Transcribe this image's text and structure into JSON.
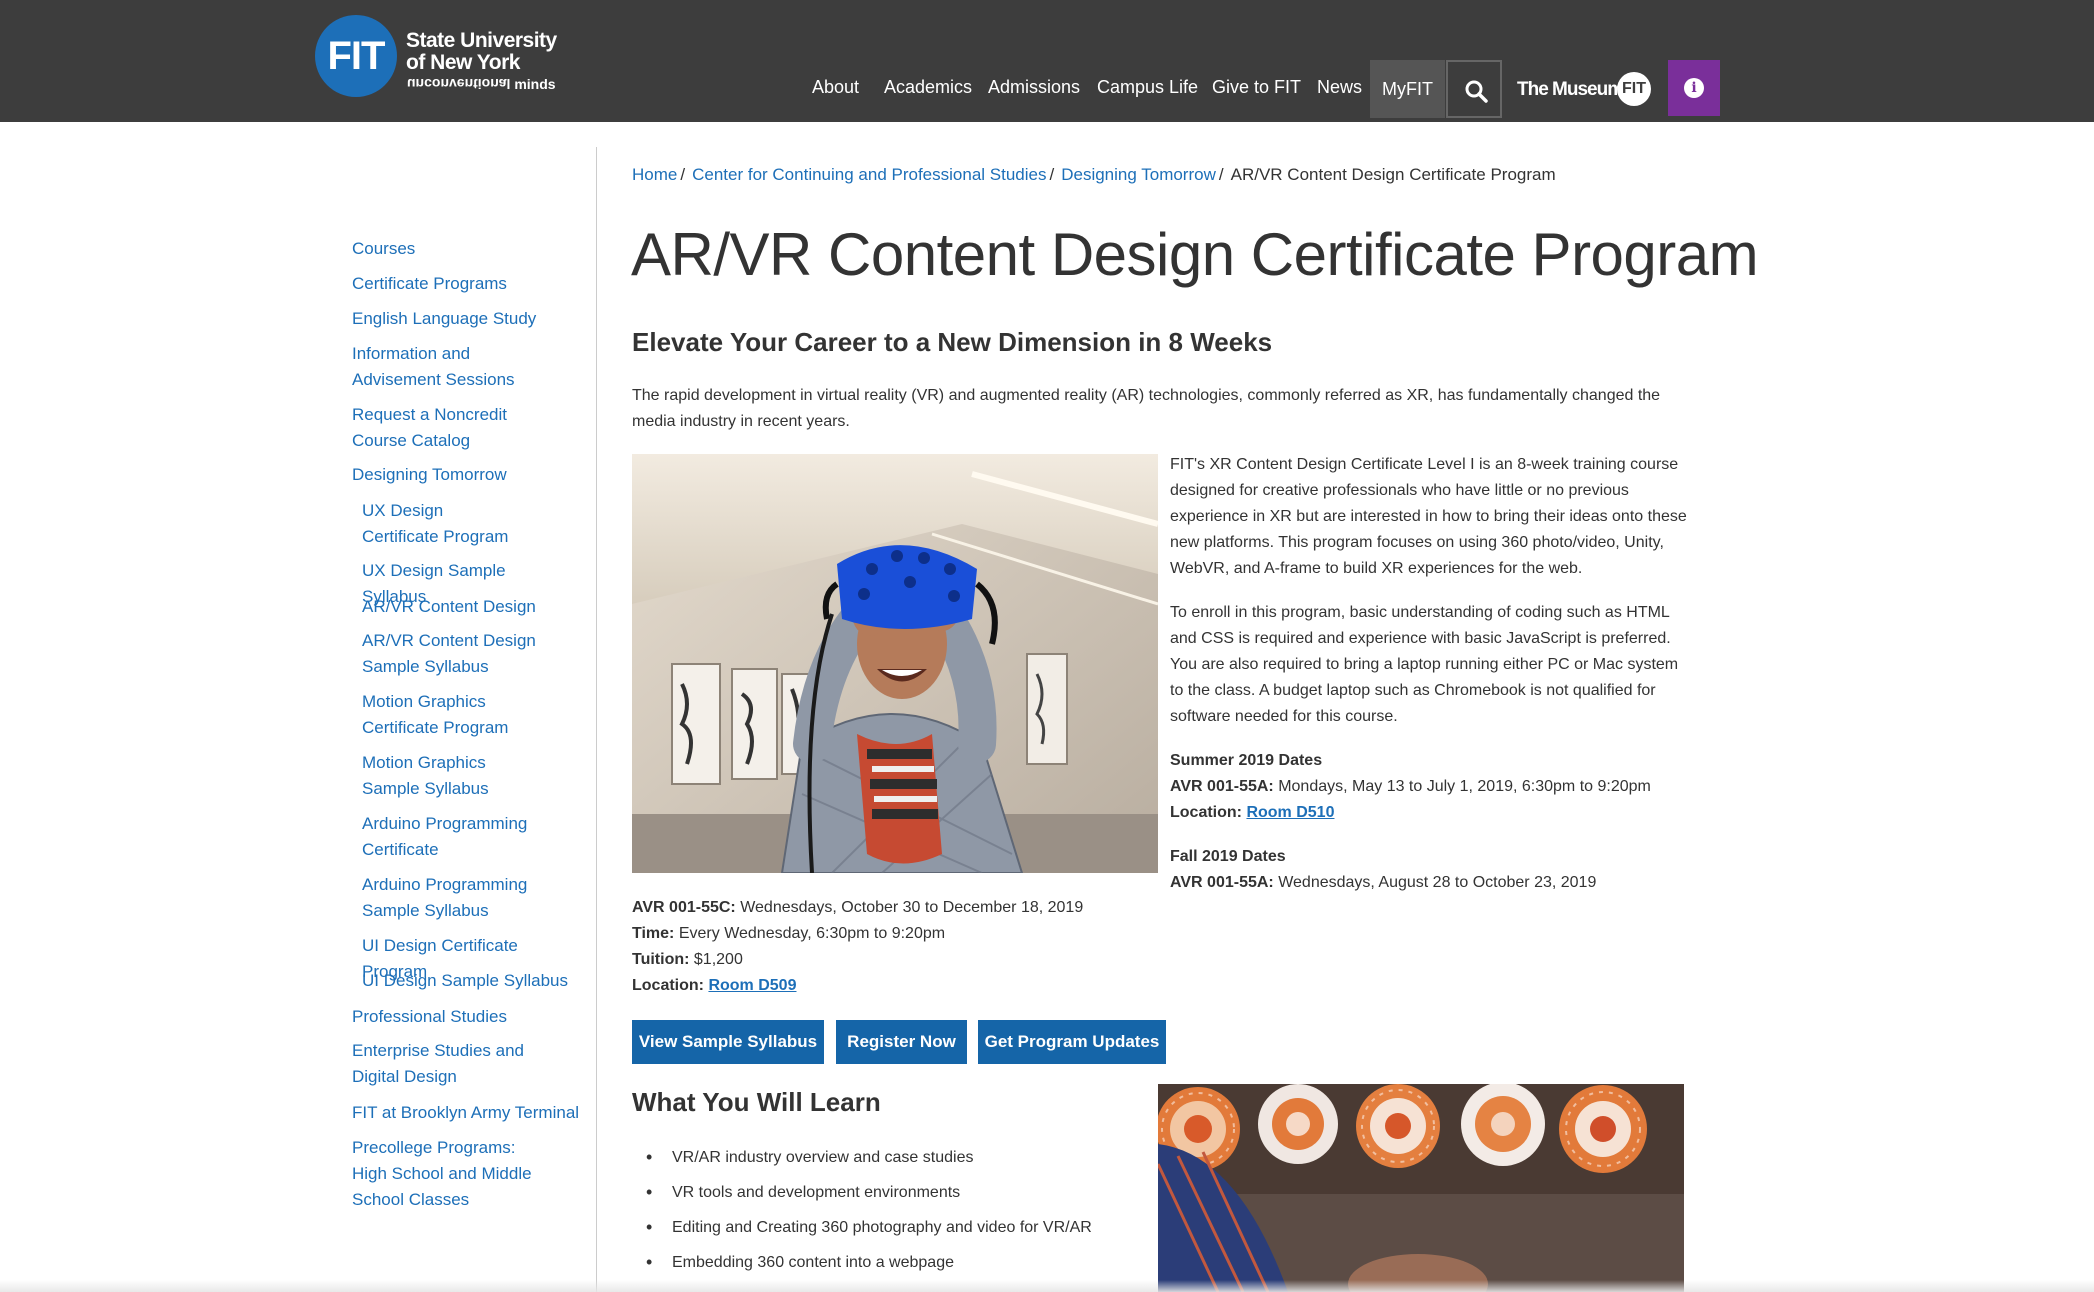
{
  "header": {
    "logo": {
      "mark": "FIT",
      "line1": "State University",
      "line2": "of New York",
      "tagline_flipped": "unconventional",
      "tagline_rest": "minds"
    },
    "nav": [
      "About",
      "Academics",
      "Admissions",
      "Campus Life",
      "Give to FIT",
      "News",
      "MyFIT"
    ],
    "museum": {
      "text": "The Museum at",
      "badge": "FIT"
    },
    "colors": {
      "header_bg": "#3d3d3d",
      "info_button": "#7a2f9a",
      "accent": "#1d6fb8"
    },
    "icons": {
      "search": "search-icon",
      "info": "info-icon"
    }
  },
  "sidebar": {
    "items": [
      {
        "label": "Courses",
        "level": 1
      },
      {
        "label": "Certificate Programs",
        "level": 1
      },
      {
        "label": "English Language Study",
        "level": 1
      },
      {
        "label": "Information and Advisement Sessions",
        "level": 1
      },
      {
        "label": "Request a Noncredit Course Catalog",
        "level": 1
      },
      {
        "label": "Designing Tomorrow",
        "level": 1
      },
      {
        "label": "UX Design Certificate Program",
        "level": 2
      },
      {
        "label": "UX Design Sample Syllabus",
        "level": 2
      },
      {
        "label": "AR/VR Content Design",
        "level": 2
      },
      {
        "label": "AR/VR Content Design Sample Syllabus",
        "level": 2
      },
      {
        "label": "Motion Graphics Certificate Program",
        "level": 2
      },
      {
        "label": "Motion Graphics Sample Syllabus",
        "level": 2
      },
      {
        "label": "Arduino Programming Certificate",
        "level": 2
      },
      {
        "label": "Arduino Programming Sample Syllabus",
        "level": 2
      },
      {
        "label": "UI Design Certificate Program",
        "level": 2
      },
      {
        "label": "UI Design Sample Syllabus",
        "level": 2
      },
      {
        "label": "Professional Studies",
        "level": 1
      },
      {
        "label": "Enterprise Studies and Digital Design",
        "level": 1
      },
      {
        "label": "FIT at Brooklyn Army Terminal",
        "level": 1
      },
      {
        "label": "Precollege Programs: High School and Middle School Classes",
        "level": 1
      }
    ]
  },
  "breadcrumb": {
    "links": [
      "Home",
      "Center for Continuing and Professional Studies",
      "Designing Tomorrow"
    ],
    "current": "AR/VR Content Design Certificate Program"
  },
  "main": {
    "title": "AR/VR Content Design Certificate Program",
    "subhead": "Elevate Your Career to a New Dimension in 8 Weeks",
    "intro": "The rapid development in virtual reality (VR) and augmented reality (AR) technologies, commonly referred as XR, has fundamentally changed the media industry in recent years.",
    "para1": "FIT's XR Content Design Certificate Level I is an 8-week training course designed for creative professionals who have little or no previous experience in XR but are interested in how to bring their ideas onto these new platforms. This program focuses on using 360 photo/video, Unity, WebVR, and A-frame to build XR experiences for the web.",
    "para2": "To enroll in this program, basic understanding of coding such as HTML and CSS is required and experience with basic JavaScript is preferred. You are also required to bring a laptop running either PC or Mac system to the class. A budget laptop such as Chromebook is not qualified for software needed for this course.",
    "summer": {
      "heading": "Summer 2019 Dates",
      "section_label": "AVR 001-55A:",
      "section_value": "Mondays, May 13 to July 1, 2019, 6:30pm to 9:20pm",
      "location_label": "Location:",
      "location_value": "Room D510"
    },
    "fall": {
      "heading": "Fall 2019 Dates",
      "section_label": "AVR 001-55A:",
      "section_value": "Wednesdays, August 28 to October 23, 2019"
    },
    "fall_more": {
      "section_label": "AVR 001-55C:",
      "section_value": "Wednesdays, October 30 to December 18, 2019",
      "time_label": "Time:",
      "time_value": "Every Wednesday, 6:30pm to 9:20pm",
      "tuition_label": "Tuition:",
      "tuition_value": "$1,200",
      "location_label": "Location:",
      "location_value": "Room D509"
    },
    "buttons": [
      "View Sample Syllabus",
      "Register Now",
      "Get Program Updates"
    ],
    "learn": {
      "title": "What You Will Learn",
      "items": [
        "VR/AR industry overview and case studies",
        "VR tools and development environments",
        "Editing and Creating 360 photography and video for VR/AR",
        "Embedding 360 content into a webpage"
      ]
    }
  }
}
